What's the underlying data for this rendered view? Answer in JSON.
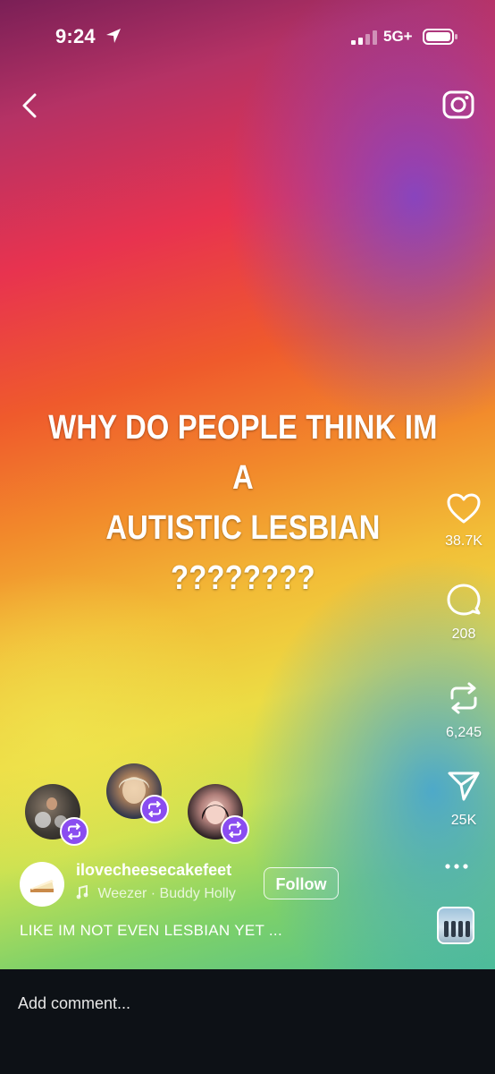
{
  "status_bar": {
    "time": "9:24",
    "network": "5G+"
  },
  "post": {
    "caption_lines": [
      "WHY DO PEOPLE THINK IM A",
      "AUTISTIC LESBIAN",
      "????????"
    ],
    "username": "ilovecheesecakefeet",
    "music_artist": "Weezer",
    "music_separator": "·",
    "music_track": "Buddy Holly",
    "follow_label": "Follow",
    "description": "LIKE IM NOT EVEN LESBIAN YET ..."
  },
  "actions": {
    "likes": "38.7K",
    "comments": "208",
    "reposts": "6,245",
    "shares": "25K"
  },
  "icons": [
    "back-icon",
    "camera-icon",
    "heart-icon",
    "comment-icon",
    "repost-icon",
    "send-icon",
    "more-icon",
    "music-note-icon",
    "location-arrow-icon"
  ],
  "comment_bar": {
    "placeholder": "Add comment..."
  },
  "colors": {
    "repost_badge": "#8a4df0",
    "comment_bar_bg": "#0d1116"
  }
}
